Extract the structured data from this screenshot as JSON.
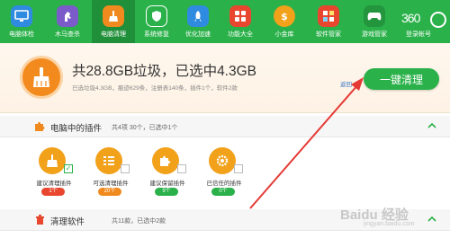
{
  "toolbar": {
    "items": [
      {
        "label": "电脑体检",
        "icon": "monitor-icon",
        "color": "#2f8be0"
      },
      {
        "label": "木马查杀",
        "icon": "horse-icon",
        "color": "#7b5ac9"
      },
      {
        "label": "电脑清理",
        "icon": "broom-icon",
        "color": "#f08a1e"
      },
      {
        "label": "系统修复",
        "icon": "shield-icon",
        "color": "#2bb14a"
      },
      {
        "label": "优化加速",
        "icon": "rocket-icon",
        "color": "#2f8be0"
      },
      {
        "label": "功能大全",
        "icon": "grid-icon",
        "color": "#e8462f"
      },
      {
        "label": "小金库",
        "icon": "coin-icon",
        "color": "#f2a11a"
      },
      {
        "label": "软件管家",
        "icon": "apps-icon",
        "color": "#e8462f"
      },
      {
        "label": "游戏管家",
        "icon": "gamepad-icon",
        "color": "#2bb14a"
      }
    ],
    "active_index": 2,
    "logo_text": "360",
    "login_text": "登录帐号"
  },
  "summary": {
    "title": "共28.8GB垃圾，已选中4.3GB",
    "detail": "已选垃圾4.3GB，痕迹629条，注册表140条，插件1个，软件2款",
    "back_label": "返回",
    "clean_button_label": "一键清理"
  },
  "plugins_section": {
    "title": "电脑中的插件",
    "count_text": "共4项 30个，已选中1个",
    "items": [
      {
        "label": "建议清理插件",
        "badge": "1个",
        "checked": true,
        "badge_color": "#e8462f",
        "icon": "broom-icon"
      },
      {
        "label": "可选清理插件",
        "badge": "20个",
        "checked": false,
        "badge_color": "#f08a1e",
        "icon": "list-icon"
      },
      {
        "label": "建议保留插件",
        "badge": "9个",
        "checked": false,
        "badge_color": "#2bb14a",
        "icon": "puzzle-icon"
      },
      {
        "label": "已信任的插件",
        "badge": "0个",
        "checked": false,
        "badge_color": "#2bb14a",
        "icon": "gear-icon"
      }
    ]
  },
  "software_section": {
    "title": "清理软件",
    "count_text": "共11款，已选中2款"
  },
  "watermark": {
    "main": "Baidu 经验",
    "sub": "jingyan.baidu.com"
  }
}
